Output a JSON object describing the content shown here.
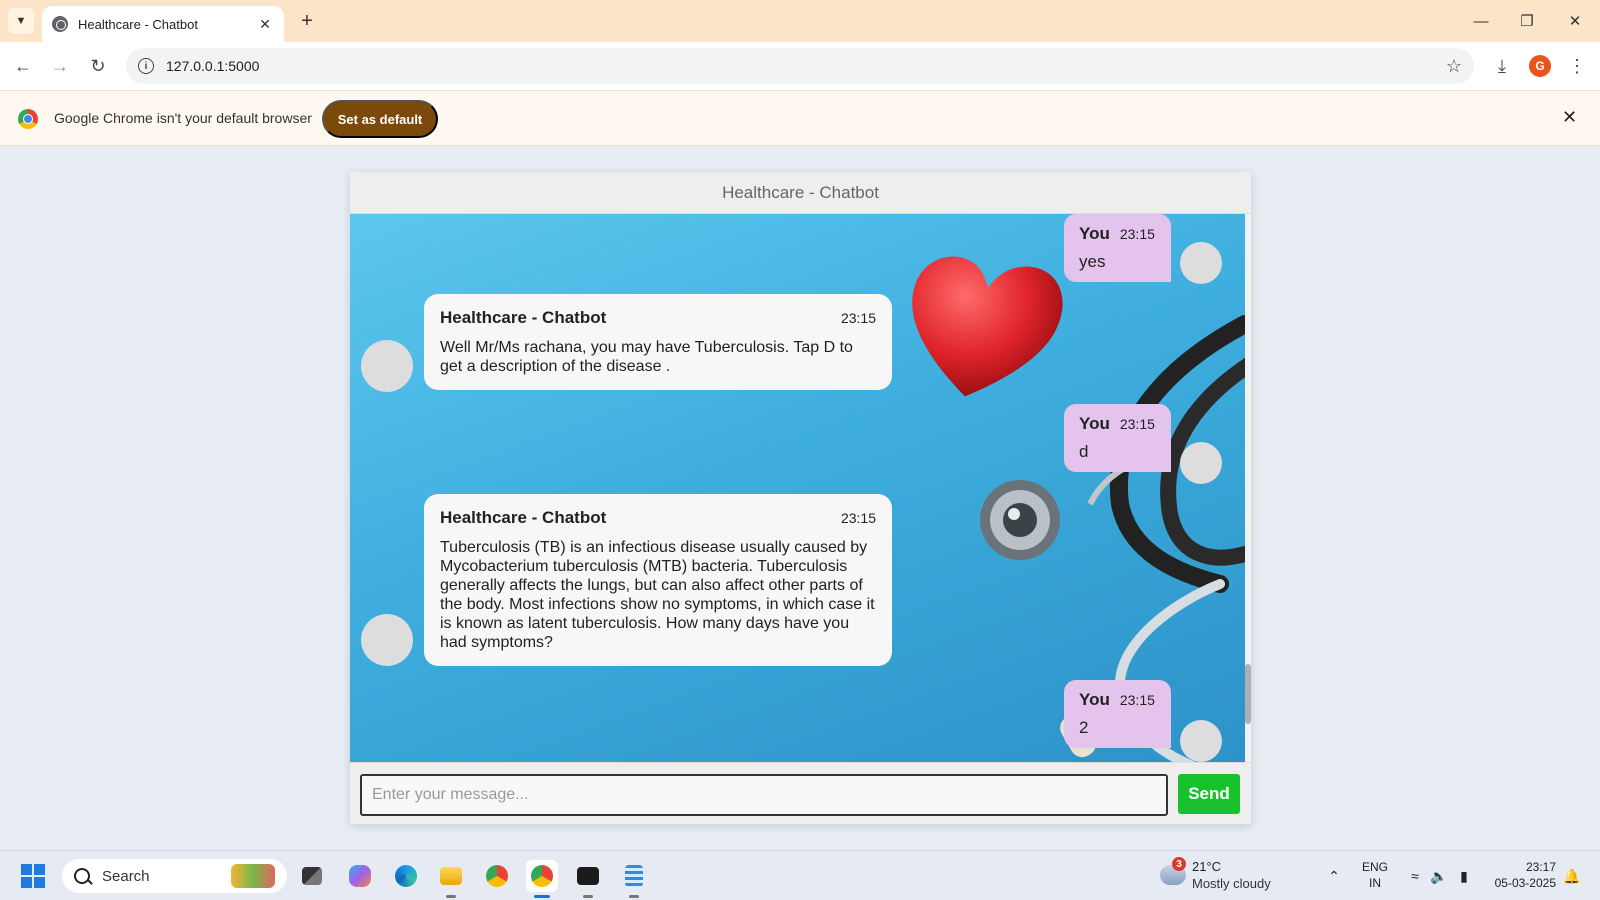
{
  "browser": {
    "tab_title": "Healthcare - Chatbot",
    "url": "127.0.0.1:5000",
    "profile_initial": "G",
    "infobar_text": "Google Chrome isn't your default browser",
    "set_default_label": "Set as default"
  },
  "chat": {
    "header_title": "Healthcare - Chatbot",
    "messages": [
      {
        "sender": "You",
        "time": "23:15",
        "text": "yes"
      },
      {
        "sender": "Healthcare - Chatbot",
        "time": "23:15",
        "text": "Well Mr/Ms rachana, you may have Tuberculosis. Tap D to get a description of the disease ."
      },
      {
        "sender": "You",
        "time": "23:15",
        "text": "d"
      },
      {
        "sender": "Healthcare - Chatbot",
        "time": "23:15",
        "text": "Tuberculosis (TB) is an infectious disease usually caused by Mycobacterium tuberculosis (MTB) bacteria. Tuberculosis generally affects the lungs, but can also affect other parts of the body. Most infections show no symptoms, in which case it is known as latent tuberculosis. How many days have you had symptoms?"
      },
      {
        "sender": "You",
        "time": "23:15",
        "text": "2"
      }
    ],
    "input_placeholder": "Enter your message...",
    "send_label": "Send"
  },
  "taskbar": {
    "search_label": "Search",
    "weather_badge": "3",
    "weather_temp": "21°C",
    "weather_condition": "Mostly cloudy",
    "lang_line1": "ENG",
    "lang_line2": "IN",
    "time": "23:17",
    "date": "05-03-2025"
  },
  "colors": {
    "chrome_titlebar": "#fbe4c7",
    "set_default_button": "#7b4a0b",
    "user_bubble": "#e4c3ec",
    "bot_bubble": "#f7f7f7",
    "send_button": "#17c22c",
    "chat_background": "#3eaede"
  }
}
